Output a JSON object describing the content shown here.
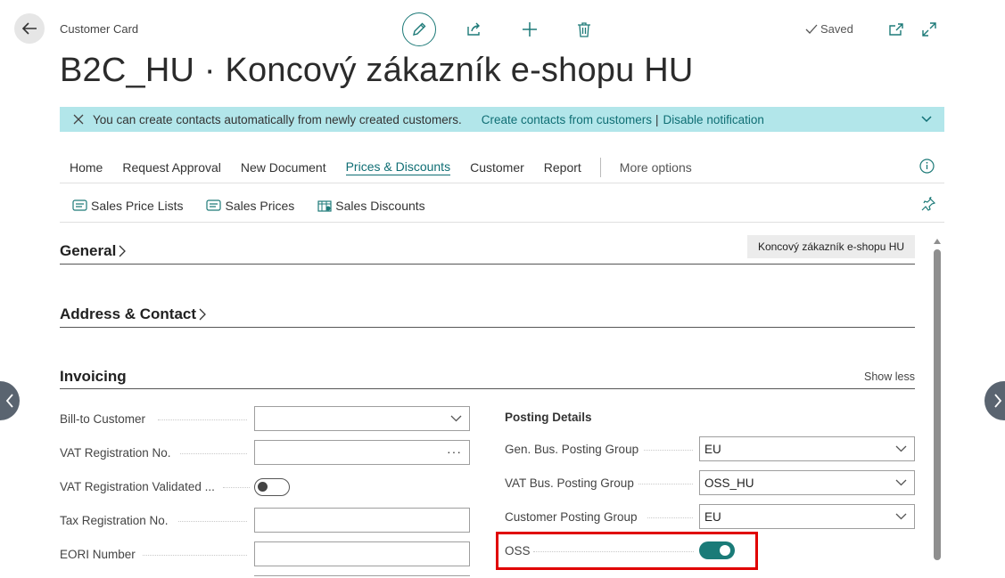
{
  "header": {
    "breadcrumb": "Customer Card",
    "title": "B2C_HU · Koncový zákazník e-shopu HU",
    "saved_label": "Saved"
  },
  "icons": {
    "back": "back-arrow-icon",
    "edit": "pencil-icon",
    "share": "share-icon",
    "new": "plus-icon",
    "delete": "trash-icon",
    "saved": "checkmark-icon",
    "open_new_window": "open-in-new-window-icon",
    "expand": "expand-icon"
  },
  "notification": {
    "message": "You can create contacts automatically from newly created customers.",
    "link1": "Create contacts from customers",
    "separator": "|",
    "link2": "Disable notification"
  },
  "menu": {
    "items": [
      "Home",
      "Request Approval",
      "New Document",
      "Prices & Discounts",
      "Customer",
      "Report"
    ],
    "active": "Prices & Discounts",
    "more": "More options"
  },
  "submenu": {
    "items": [
      "Sales Price Lists",
      "Sales Prices",
      "Sales Discounts"
    ]
  },
  "sections": {
    "general": {
      "title": "General",
      "summary": "Koncový zákazník e-shopu HU"
    },
    "address": {
      "title": "Address & Contact"
    },
    "invoicing": {
      "title": "Invoicing",
      "show_less": "Show less",
      "left_fields": [
        {
          "label": "Bill-to Customer",
          "value": "",
          "type": "dropdown"
        },
        {
          "label": "VAT Registration No.",
          "value": "",
          "type": "lookup"
        },
        {
          "label": "VAT Registration Validated ...",
          "value": false,
          "type": "toggle"
        },
        {
          "label": "Tax Registration No.",
          "value": "",
          "type": "text"
        },
        {
          "label": "EORI Number",
          "value": "",
          "type": "text"
        }
      ],
      "posting_details": {
        "heading": "Posting Details",
        "fields": [
          {
            "label": "Gen. Bus. Posting Group",
            "value": "EU",
            "type": "dropdown"
          },
          {
            "label": "VAT Bus. Posting Group",
            "value": "OSS_HU",
            "type": "dropdown"
          },
          {
            "label": "Customer Posting Group",
            "value": "EU",
            "type": "dropdown"
          },
          {
            "label": "OSS",
            "value": true,
            "type": "toggle"
          }
        ]
      }
    }
  },
  "colors": {
    "accent": "#0f6e74",
    "notification_bg": "#b2e6ea",
    "toggle_on": "#1a7b78",
    "highlight": "#e00000"
  }
}
